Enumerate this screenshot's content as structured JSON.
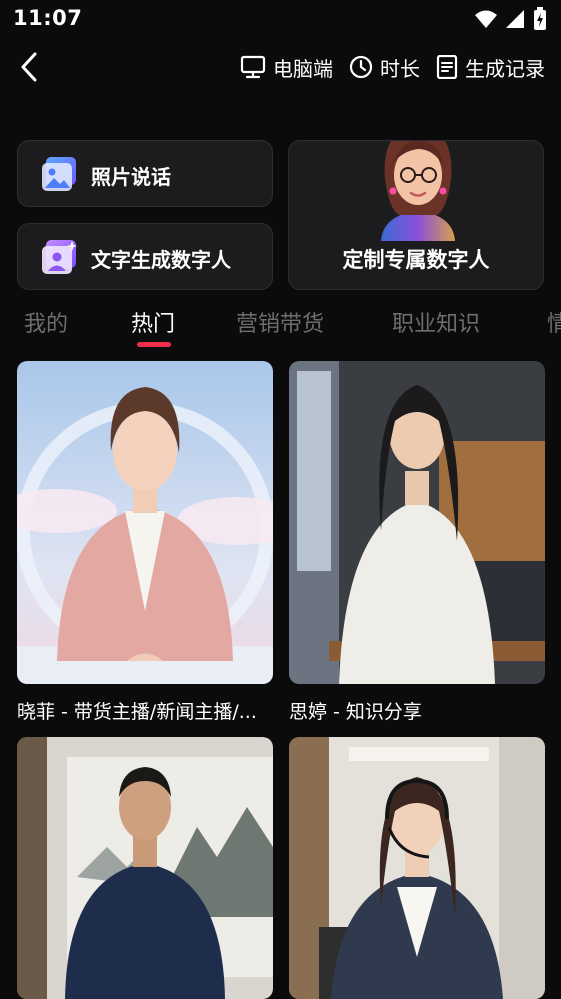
{
  "status_bar": {
    "time": "11:07"
  },
  "nav": {
    "desktop_label": "电脑端",
    "duration_label": "时长",
    "history_label": "生成记录"
  },
  "feature_cards": {
    "photo_talk": "照片说话",
    "text_to_avatar": "文字生成数字人",
    "custom_avatar": "定制专属数字人"
  },
  "tabs": [
    {
      "label": "我的"
    },
    {
      "label": "热门"
    },
    {
      "label": "营销带货"
    },
    {
      "label": "职业知识"
    },
    {
      "label": "情"
    }
  ],
  "active_tab": "热门",
  "avatars": [
    {
      "caption": "晓菲 - 带货主播/新闻主播/..."
    },
    {
      "caption": "思婷 - 知识分享"
    },
    {
      "caption": ""
    },
    {
      "caption": ""
    }
  ],
  "colors": {
    "background": "#0b0b0b",
    "card": "#1c1c1e",
    "accent": "#f0304a",
    "tab_inactive": "#6e6e70"
  }
}
